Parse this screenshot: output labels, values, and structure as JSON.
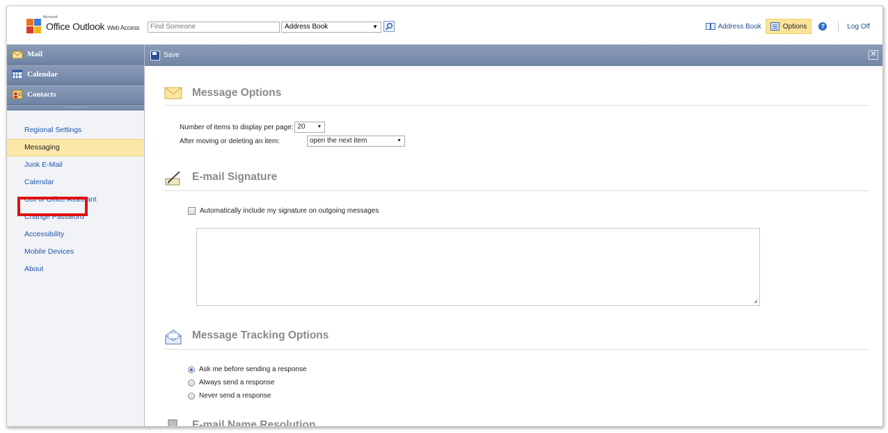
{
  "app": {
    "ms_tag": "Microsoft",
    "title_main": "Office Outlook",
    "title_small": "Web Access"
  },
  "search": {
    "placeholder": "Find Someone",
    "scope": "Address Book"
  },
  "top_right": {
    "address_book": "Address Book",
    "options": "Options",
    "help": "?",
    "log_off": "Log Off"
  },
  "nav": {
    "mail": "Mail",
    "calendar": "Calendar",
    "contacts": "Contacts",
    "grip": "..........",
    "items": [
      {
        "label": "Regional Settings"
      },
      {
        "label": "Messaging"
      },
      {
        "label": "Junk E-Mail"
      },
      {
        "label": "Calendar"
      },
      {
        "label": "Out of Office Assistant"
      },
      {
        "label": "Change Password"
      },
      {
        "label": "Accessibility"
      },
      {
        "label": "Mobile Devices"
      },
      {
        "label": "About"
      }
    ]
  },
  "toolbar": {
    "save": "Save",
    "close": "✕"
  },
  "message_options": {
    "title": "Message Options",
    "items_label": "Number of items to display per page:",
    "items_value": "20",
    "after_move_label": "After moving or deleting an item:",
    "after_move_value": "open the next item"
  },
  "signature": {
    "title": "E-mail Signature",
    "auto_include": "Automatically include my signature on outgoing messages"
  },
  "tracking": {
    "title": "Message Tracking Options",
    "options": [
      {
        "label": "Ask me before sending a response",
        "selected": true
      },
      {
        "label": "Always send a response",
        "selected": false
      },
      {
        "label": "Never send a response",
        "selected": false
      }
    ]
  },
  "name_resolution": {
    "title": "E-mail Name Resolution"
  },
  "colors": {
    "nav_header": "#7f91ae",
    "link": "#1f57a8",
    "selected_bg": "#fbe7a8",
    "highlight": "#e01010"
  }
}
